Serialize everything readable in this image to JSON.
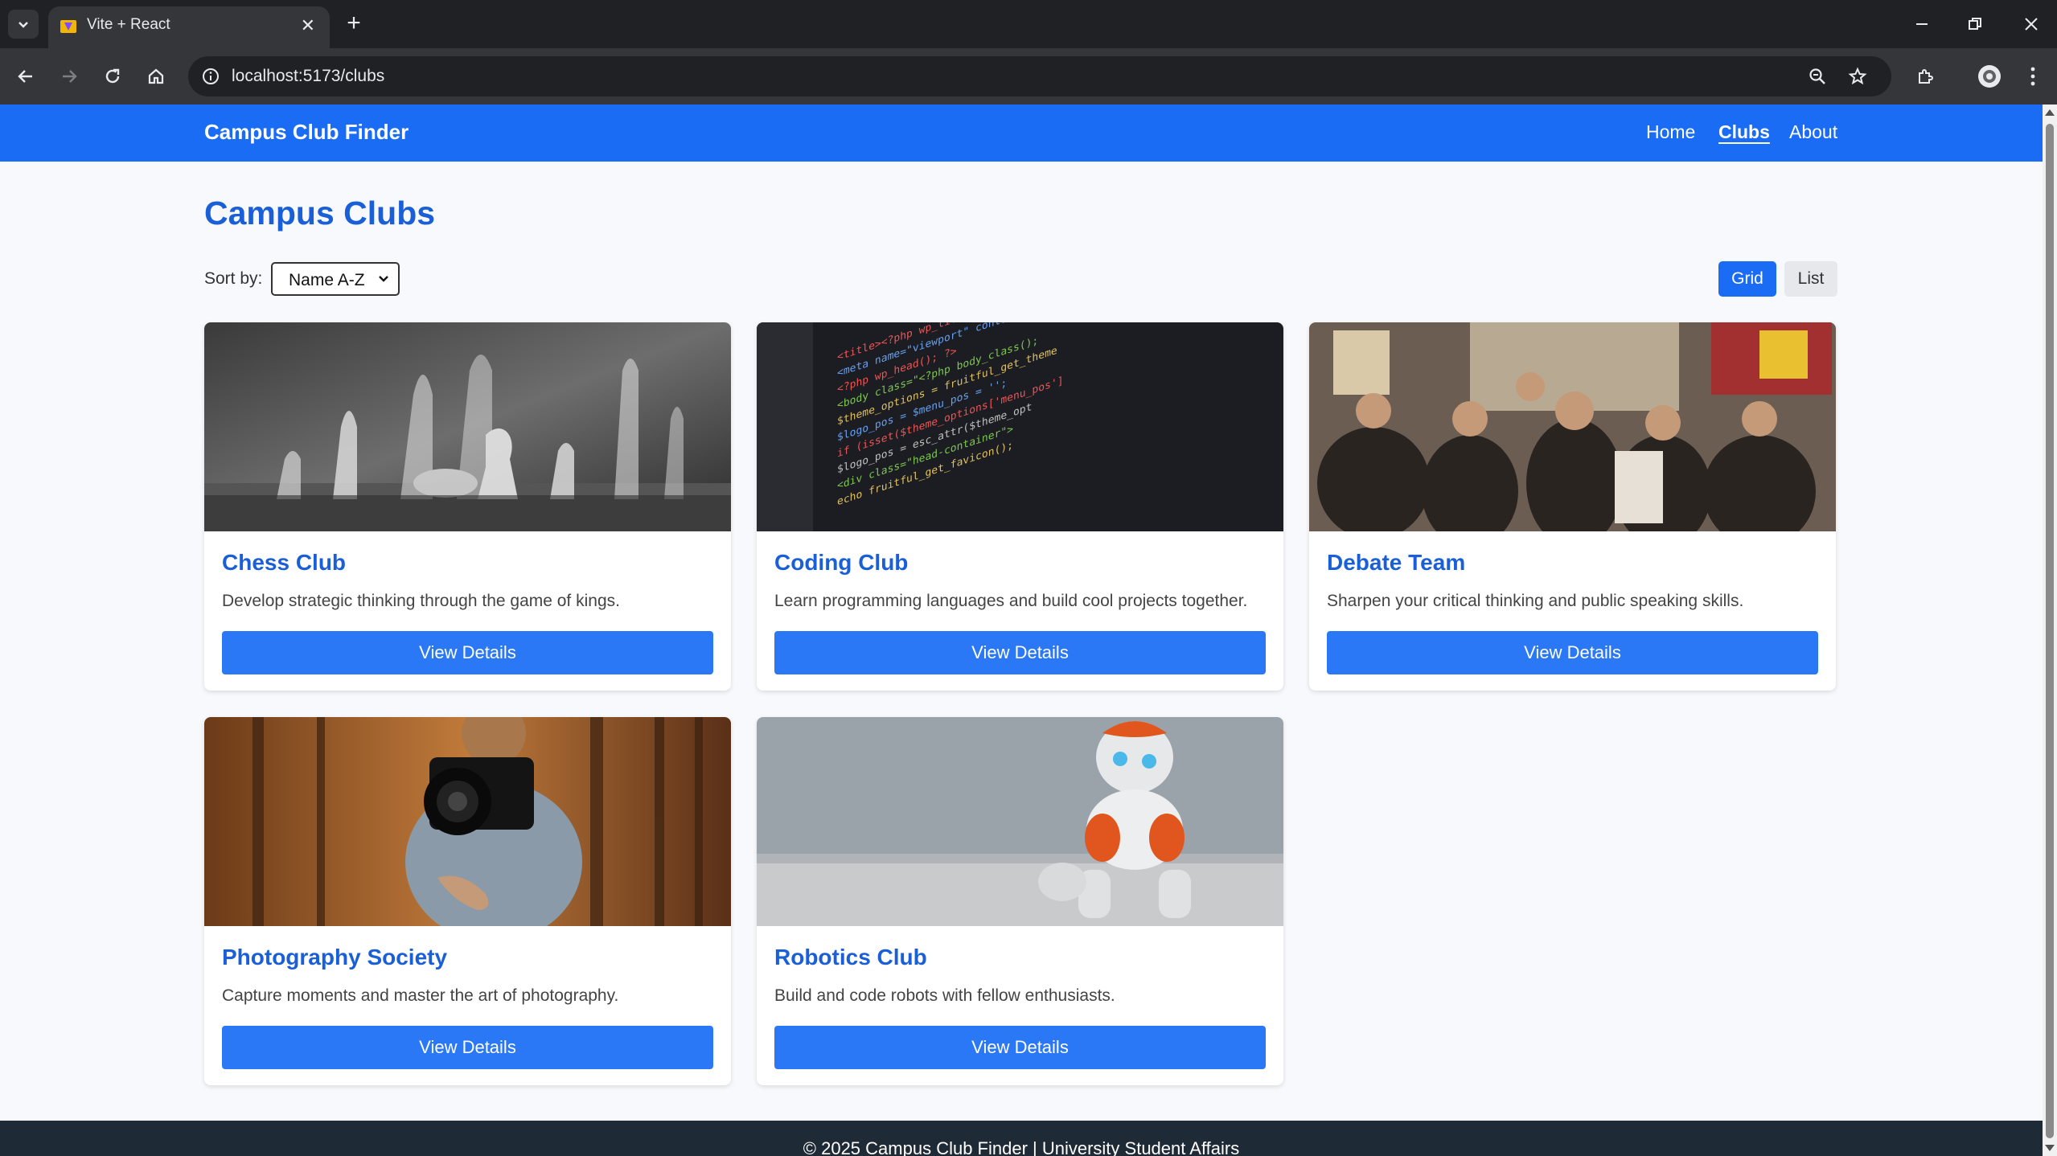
{
  "browser": {
    "tab_title": "Vite + React",
    "url": "localhost:5173/clubs"
  },
  "nav": {
    "brand": "Campus Club Finder",
    "links": [
      "Home",
      "Clubs",
      "About"
    ],
    "active": "Clubs"
  },
  "page": {
    "title": "Campus Clubs",
    "sort_label": "Sort by:",
    "sort_value": "Name A-Z",
    "view_grid": "Grid",
    "view_list": "List",
    "active_view": "Grid"
  },
  "clubs": [
    {
      "name": "Chess Club",
      "description": "Develop strategic thinking through the game of kings.",
      "button": "View Details",
      "image": "chess-photo"
    },
    {
      "name": "Coding Club",
      "description": "Learn programming languages and build cool projects together.",
      "button": "View Details",
      "image": "code-screen-photo"
    },
    {
      "name": "Debate Team",
      "description": "Sharpen your critical thinking and public speaking skills.",
      "button": "View Details",
      "image": "group-discussion-photo"
    },
    {
      "name": "Photography Society",
      "description": "Capture moments and master the art of photography.",
      "button": "View Details",
      "image": "camera-photo"
    },
    {
      "name": "Robotics Club",
      "description": "Build and code robots with fellow enthusiasts.",
      "button": "View Details",
      "image": "robot-photo"
    }
  ],
  "footer": {
    "text": "© 2025 Campus Club Finder | University Student Affairs"
  },
  "colors": {
    "primary": "#1a6cf5",
    "heading": "#1a5fd8",
    "footer_bg": "#1f2a37"
  }
}
